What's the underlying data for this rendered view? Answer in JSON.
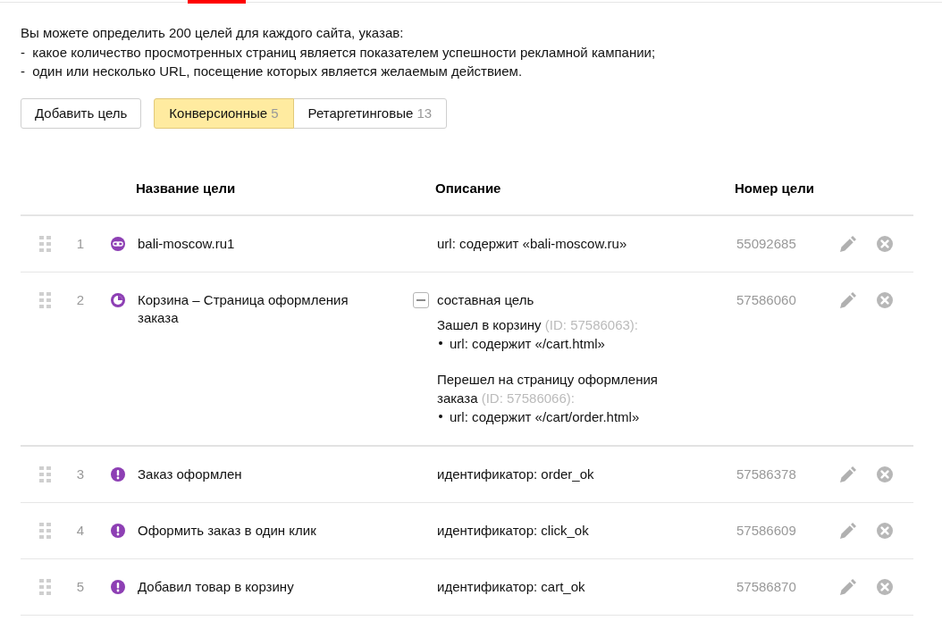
{
  "intro": {
    "text": "Вы можете определить 200 целей для каждого сайта, указав:",
    "items": [
      "-  какое количество просмотренных страниц является показателем успешности рекламной кампании;",
      "-  один или несколько URL, посещение которых является желаемым действием."
    ]
  },
  "add_goal_button": "Добавить цель",
  "tabs": [
    {
      "label": "Конверсионные",
      "count": "5",
      "selected": true
    },
    {
      "label": "Ретаргетинговые",
      "count": "13",
      "selected": false
    }
  ],
  "table": {
    "columns": [
      "Название цели",
      "Описание",
      "Номер цели"
    ],
    "rows": [
      {
        "number": "1",
        "kind": "url",
        "name": "bali-moscow.ru1",
        "description": "url: содержит «bali-moscow.ru»",
        "goal_id": "55092685"
      },
      {
        "number": "2",
        "kind": "composite",
        "name": "Корзина – Страница оформления заказа",
        "expanded": true,
        "description": "составная цель",
        "steps": [
          {
            "title": "Зашел в корзину",
            "id_note": "(ID: 57586063):",
            "conditions": [
              "url: содержит «/cart.html»"
            ]
          },
          {
            "title": "Перешел на страницу оформления заказа",
            "id_note": "(ID: 57586066):",
            "conditions": [
              "url: содержит «/cart/order.html»"
            ]
          }
        ],
        "goal_id": "57586060"
      },
      {
        "number": "3",
        "kind": "event",
        "name": "Заказ оформлен",
        "description": "идентификатор: order_ok",
        "goal_id": "57586378"
      },
      {
        "number": "4",
        "kind": "event",
        "name": "Оформить заказ в один клик",
        "description": "идентификатор: click_ok",
        "goal_id": "57586609"
      },
      {
        "number": "5",
        "kind": "event",
        "name": "Добавил товар в корзину",
        "description": "идентификатор: cart_ok",
        "goal_id": "57586870"
      }
    ]
  }
}
